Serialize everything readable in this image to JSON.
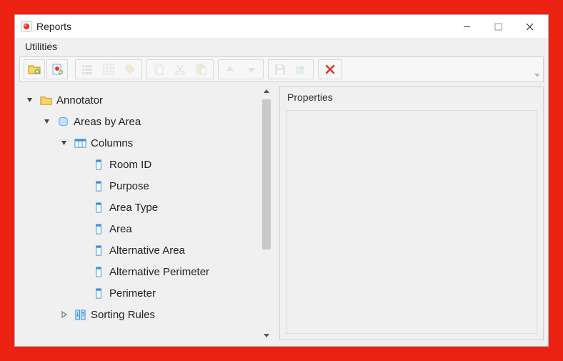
{
  "window": {
    "title": "Reports"
  },
  "menu": {
    "utilities": "Utilities"
  },
  "tree": {
    "annotator": "Annotator",
    "areas_by_area": "Areas by Area",
    "columns": "Columns",
    "room_id": "Room ID",
    "purpose": "Purpose",
    "area_type": "Area Type",
    "area": "Area",
    "alt_area": "Alternative Area",
    "alt_perimeter": "Alternative Perimeter",
    "perimeter": "Perimeter",
    "sorting_rules": "Sorting Rules"
  },
  "props": {
    "header": "Properties"
  }
}
